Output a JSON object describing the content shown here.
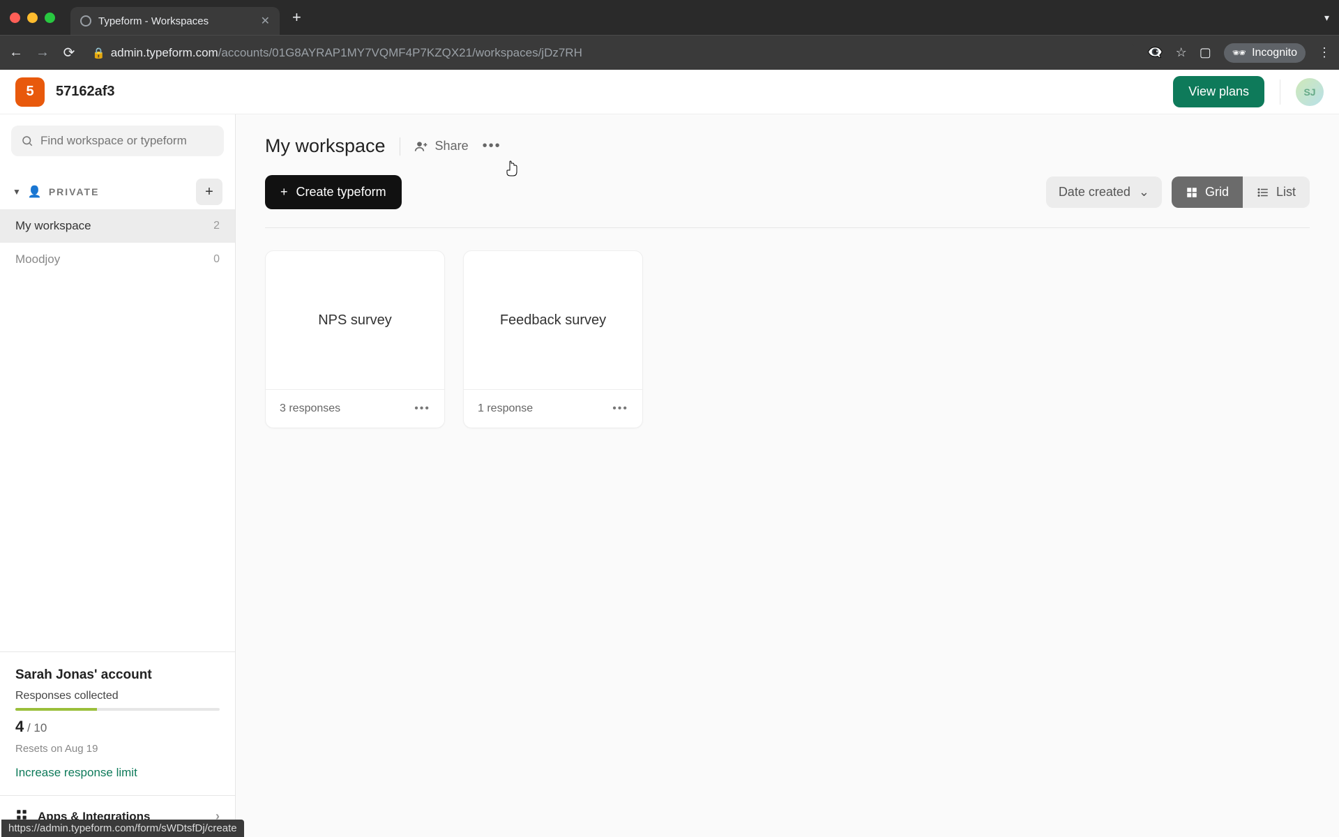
{
  "browser": {
    "tab_title": "Typeform - Workspaces",
    "url_host": "admin.typeform.com",
    "url_path": "/accounts/01G8AYRAP1MY7VQMF4P7KZQX21/workspaces/jDz7RH",
    "incognito_label": "Incognito",
    "status_url": "https://admin.typeform.com/form/sWDtsfDj/create"
  },
  "header": {
    "org_initial": "5",
    "org_name": "57162af3",
    "view_plans": "View plans",
    "avatar_initials": "SJ"
  },
  "sidebar": {
    "search_placeholder": "Find workspace or typeform",
    "section_label": "PRIVATE",
    "workspaces": [
      {
        "name": "My workspace",
        "count": "2",
        "selected": true
      },
      {
        "name": "Moodjoy",
        "count": "0",
        "selected": false
      }
    ],
    "account": {
      "name": "Sarah Jonas' account",
      "responses_label": "Responses collected",
      "used": "4",
      "total": "10",
      "percent": 40,
      "resets": "Resets on Aug 19",
      "increase": "Increase response limit"
    },
    "apps_label": "Apps & Integrations"
  },
  "main": {
    "title": "My workspace",
    "share_label": "Share",
    "create_label": "Create typeform",
    "sort_label": "Date created",
    "grid_label": "Grid",
    "list_label": "List",
    "cards": [
      {
        "title": "NPS survey",
        "responses": "3 responses"
      },
      {
        "title": "Feedback survey",
        "responses": "1 response"
      }
    ]
  }
}
